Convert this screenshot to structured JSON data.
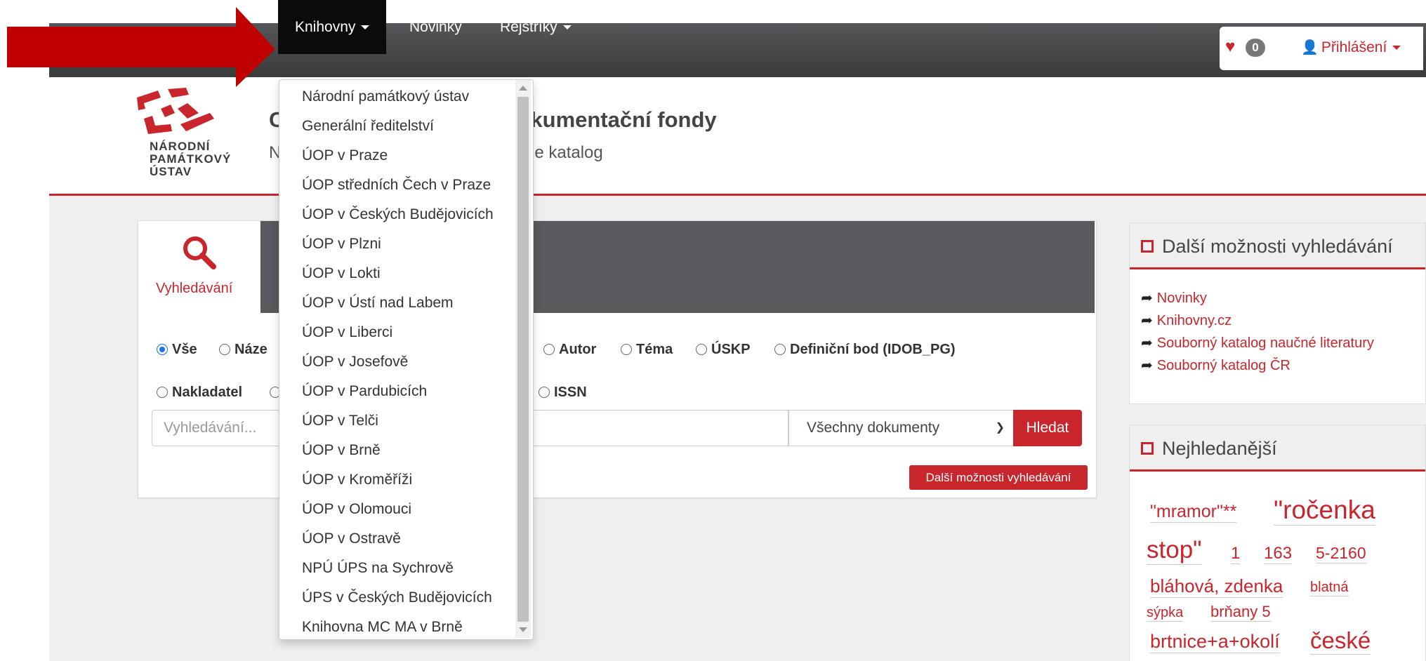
{
  "navbar": {
    "items": [
      {
        "label": "Knihovny"
      },
      {
        "label": "Novinky"
      },
      {
        "label": "Rejstříky"
      }
    ],
    "favorites_count": "0",
    "login_label": "Přihlášení"
  },
  "header": {
    "logo_text": "NÁRODNÍ\nPAMÁTKOVÝ\nÚSTAV",
    "title_prefix": "C",
    "title_suffix": "kumentační fondy",
    "subtitle_prefix": "N",
    "subtitle_suffix": "e katalog"
  },
  "search": {
    "tab_label": "Vyhledávání",
    "row1": [
      {
        "label": "Vše",
        "checked": true
      },
      {
        "label": "Náze"
      },
      {
        "label": "Autor"
      },
      {
        "label": "Téma"
      },
      {
        "label": "ÚSKP"
      },
      {
        "label": "Definiční bod (IDOB_PG)"
      }
    ],
    "row2": [
      {
        "label": "Nakladatel"
      },
      {
        "label": "ISSN"
      }
    ],
    "input_placeholder": "Vyhledávání...",
    "doc_type_selected": "Všechny dokumenty",
    "search_button": "Hledat",
    "advanced_button": "Další možnosti vyhledávání"
  },
  "dropdown": {
    "items": [
      "Národní památkový ústav",
      "Generální ředitelství",
      "ÚOP v Praze",
      "ÚOP středních Čech v Praze",
      "ÚOP v Českých Budějovicích",
      "ÚOP v Plzni",
      "ÚOP v Lokti",
      "ÚOP v Ústí nad Labem",
      "ÚOP v Liberci",
      "ÚOP v Josefově",
      "ÚOP v Pardubicích",
      "ÚOP v Telči",
      "ÚOP v Brně",
      "ÚOP v Kroměříži",
      "ÚOP v Olomouci",
      "ÚOP v Ostravě",
      "NPÚ ÚPS na Sychrově",
      "ÚPS v Českých Budějovicích",
      "Knihovna MC MA v Brně"
    ]
  },
  "sidebar": {
    "more_title": "Další možnosti vyhledávání",
    "links": [
      "Novinky",
      "Knihovny.cz",
      "Souborný katalog naučné literatury",
      "Souborný katalog ČR"
    ],
    "popular_title": "Nejhledanější",
    "tags": [
      "\"mramor\"**",
      "\"ročenka",
      "stop\"",
      "1",
      "163",
      "5-2160",
      "bláhová, zdenka",
      "blatná",
      "sýpka",
      "brňany 5",
      "brtnice+a+okolí",
      "české"
    ]
  },
  "colors": {
    "accent": "#c9252c",
    "navbar": "#4a4b4e",
    "arrow": "#c00000"
  }
}
